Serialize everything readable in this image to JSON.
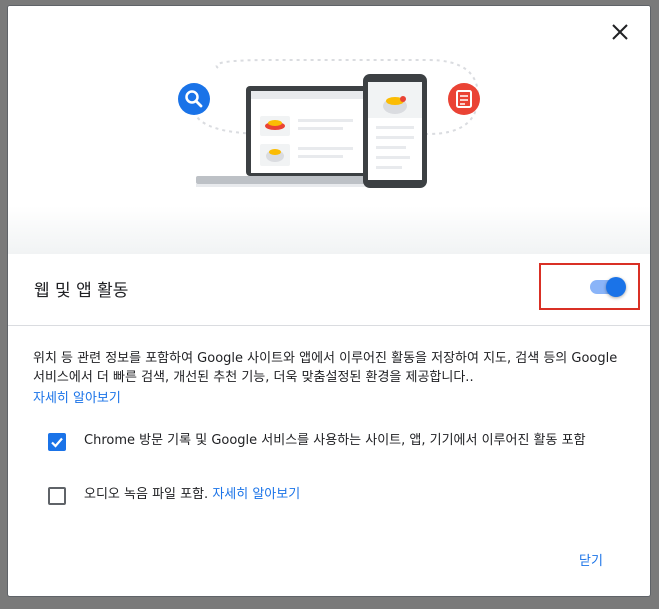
{
  "dialog": {
    "title": "웹 및 앱 활동",
    "toggle_on": true,
    "description": "위치 등 관련 정보를 포함하여 Google 사이트와 앱에서 이루어진 활동을 저장하여 지도, 검색 등의 Google 서비스에서 더 빠른 검색, 개선된 추천 기능, 더욱 맞춤설정된 환경을 제공합니다..",
    "learn_more": "자세히 알아보기",
    "options": [
      {
        "label": "Chrome 방문 기록 및 Google 서비스를 사용하는 사이트, 앱, 기기에서 이루어진 활동 포함",
        "checked": true
      },
      {
        "label": "오디오 녹음 파일 포함.",
        "link": "자세히 알아보기",
        "checked": false
      }
    ],
    "close_label": "닫기"
  },
  "icons": {
    "close": "close-icon",
    "search": "search-icon",
    "document": "document-icon",
    "checkmark": "checkmark-icon"
  },
  "colors": {
    "accent": "#1a73e8",
    "toggle_track": "#8ab4f8",
    "search_badge": "#1a73e8",
    "doc_badge": "#ea4335",
    "highlight_border": "#d93025"
  }
}
